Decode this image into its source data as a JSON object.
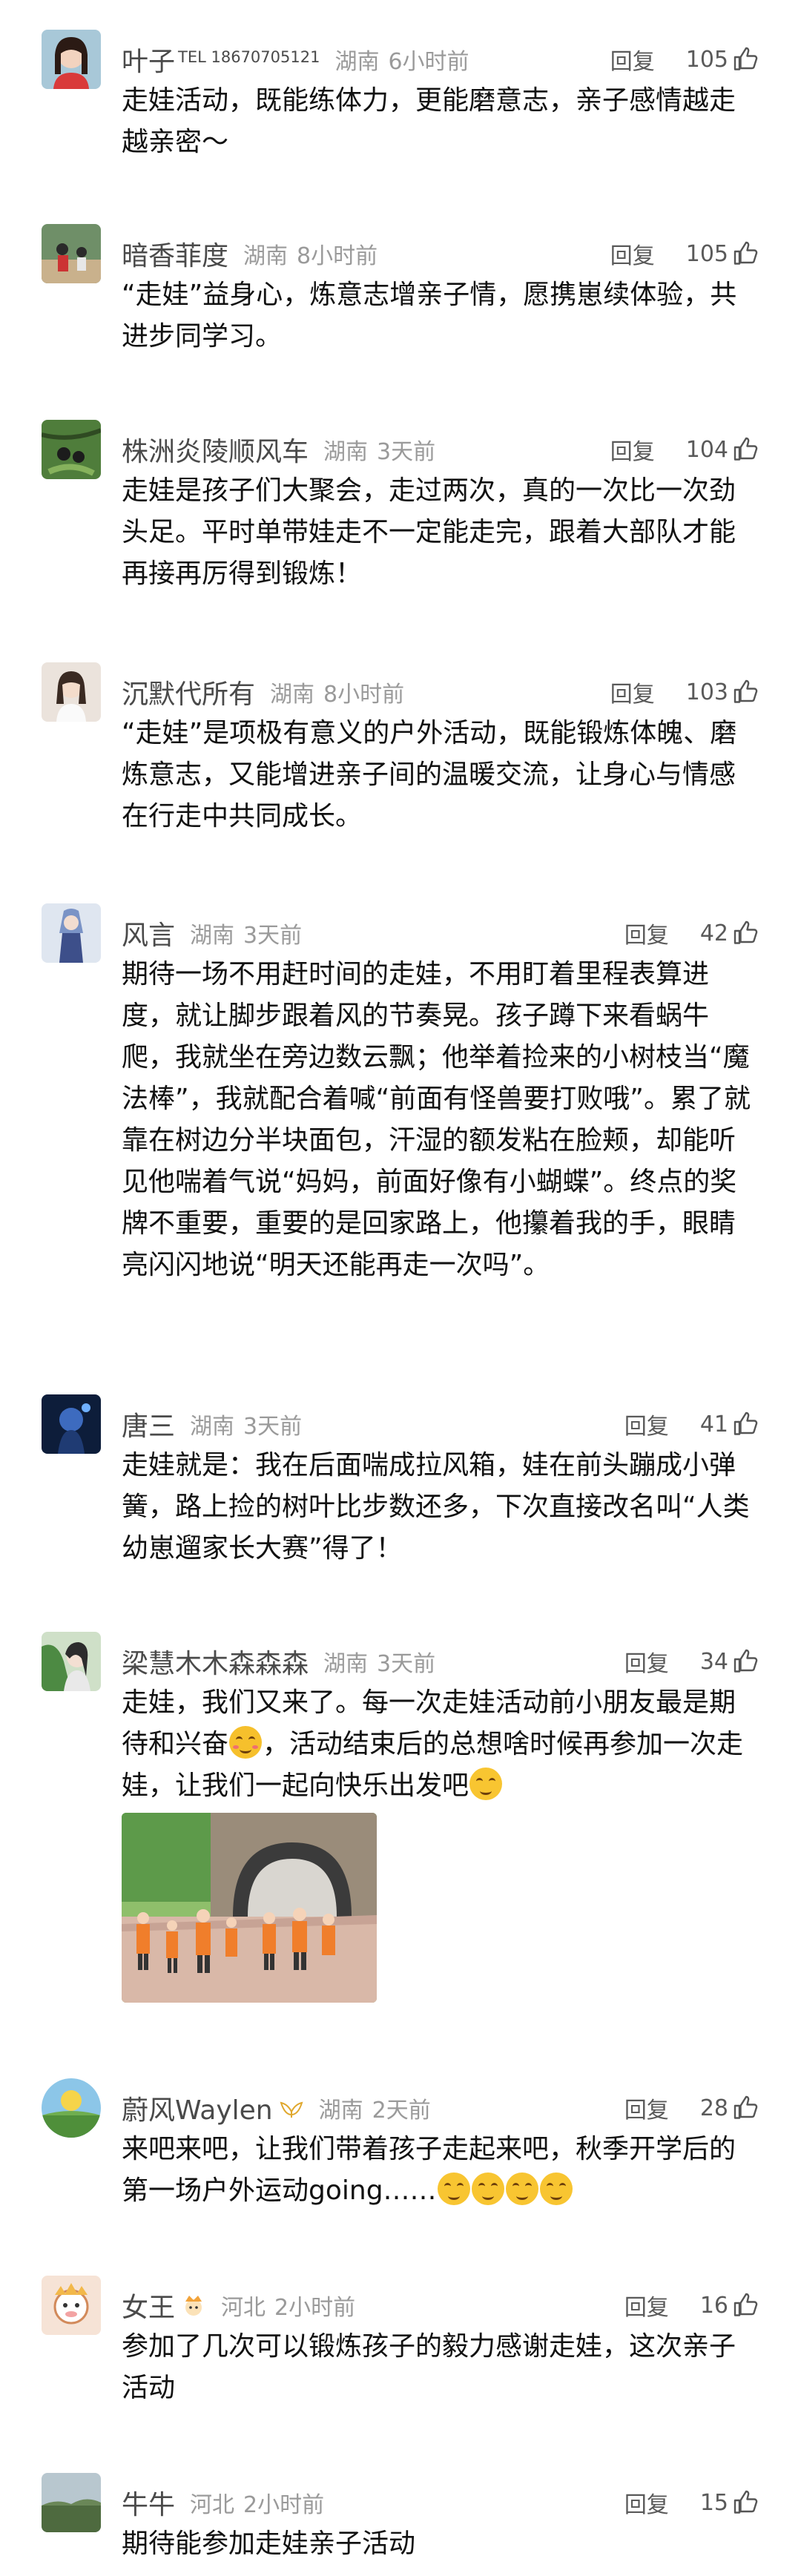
{
  "comments": [
    {
      "name": "叶子",
      "tag": "TEL 18670705121",
      "location": "湖南",
      "time": "6小时前",
      "reply": "回复",
      "likes": "105",
      "text": "走娃活动，既能练体力，更能磨意志，亲子感情越走越亲密～"
    },
    {
      "name": "暗香菲度",
      "location": "湖南",
      "time": "8小时前",
      "reply": "回复",
      "likes": "105",
      "text": "“走娃”益身心，炼意志增亲子情，愿携崽续体验，共进步同学习。"
    },
    {
      "name": "株洲炎陵顺风车",
      "location": "湖南",
      "time": "3天前",
      "reply": "回复",
      "likes": "104",
      "text": "走娃是孩子们大聚会，走过两次，真的一次比一次劲头足。平时单带娃走不一定能走完，跟着大部队才能再接再厉得到锻炼！"
    },
    {
      "name": "沉默代所有",
      "location": "湖南",
      "time": "8小时前",
      "reply": "回复",
      "likes": "103",
      "text": "“走娃”是项极有意义的户外活动，既能锻炼体魄、磨炼意志，又能增进亲子间的温暖交流，让身心与情感在行走中共同成长。"
    },
    {
      "name": "风言",
      "location": "湖南",
      "time": "3天前",
      "reply": "回复",
      "likes": "42",
      "text": "期待一场不用赶时间的走娃，不用盯着里程表算进度，就让脚步跟着风的节奏晃。孩子蹲下来看蜗牛爬，我就坐在旁边数云飘；他举着捡来的小树枝当“魔法棒”，我就配合着喊“前面有怪兽要打败哦”。累了就靠在树边分半块面包，汗湿的额发粘在脸颊，却能听见他喘着气说“妈妈，前面好像有小蝴蝶”。终点的奖牌不重要，重要的是回家路上，他攥着我的手，眼睛亮闪闪地说“明天还能再走一次吗”。"
    },
    {
      "name": "唐三",
      "location": "湖南",
      "time": "3天前",
      "reply": "回复",
      "likes": "41",
      "text": "走娃就是：我在后面喘成拉风箱，娃在前头蹦成小弹簧，路上捡的树叶比步数还多，下次直接改名叫“人类幼崽遛家长大赛”得了！"
    },
    {
      "name": "梁慧木木森森森",
      "location": "湖南",
      "time": "3天前",
      "reply": "回复",
      "likes": "34",
      "text_parts": [
        "走娃，我们又来了。每一次走娃活动前小朋友最是期待和兴奋",
        "，活动结束后的总想啥时候再参加一次走娃，让我们一起向快乐出发吧"
      ],
      "emojis": [
        "smiling-hearts-emoji",
        "smile-emoji"
      ]
    },
    {
      "name": "蔚风Waylen",
      "location": "湖南",
      "time": "2天前",
      "reply": "回复",
      "likes": "28",
      "text": "来吧来吧，让我们带着孩子走起来吧，秋季开学后的第一场户外运动going……",
      "emojis": [
        "salute-emoji",
        "salute-emoji",
        "salute-emoji",
        "salute-emoji"
      ]
    },
    {
      "name": "女王",
      "location": "河北",
      "time": "2小时前",
      "reply": "回复",
      "likes": "16",
      "text": "参加了几次可以锻炼孩子的毅力感谢走娃，这次亲子活动"
    },
    {
      "name": "牛牛",
      "location": "河北",
      "time": "2小时前",
      "reply": "回复",
      "likes": "15",
      "text": "期待能参加走娃亲子活动"
    }
  ],
  "colors": {
    "text": "#111111",
    "meta": "#9a9a9a",
    "name": "#4a4a4a",
    "background": "#ffffff"
  },
  "icons": {
    "like": "thumb-up-icon",
    "badge_crown": "crown-icon",
    "badge_wings": "wings-icon"
  }
}
